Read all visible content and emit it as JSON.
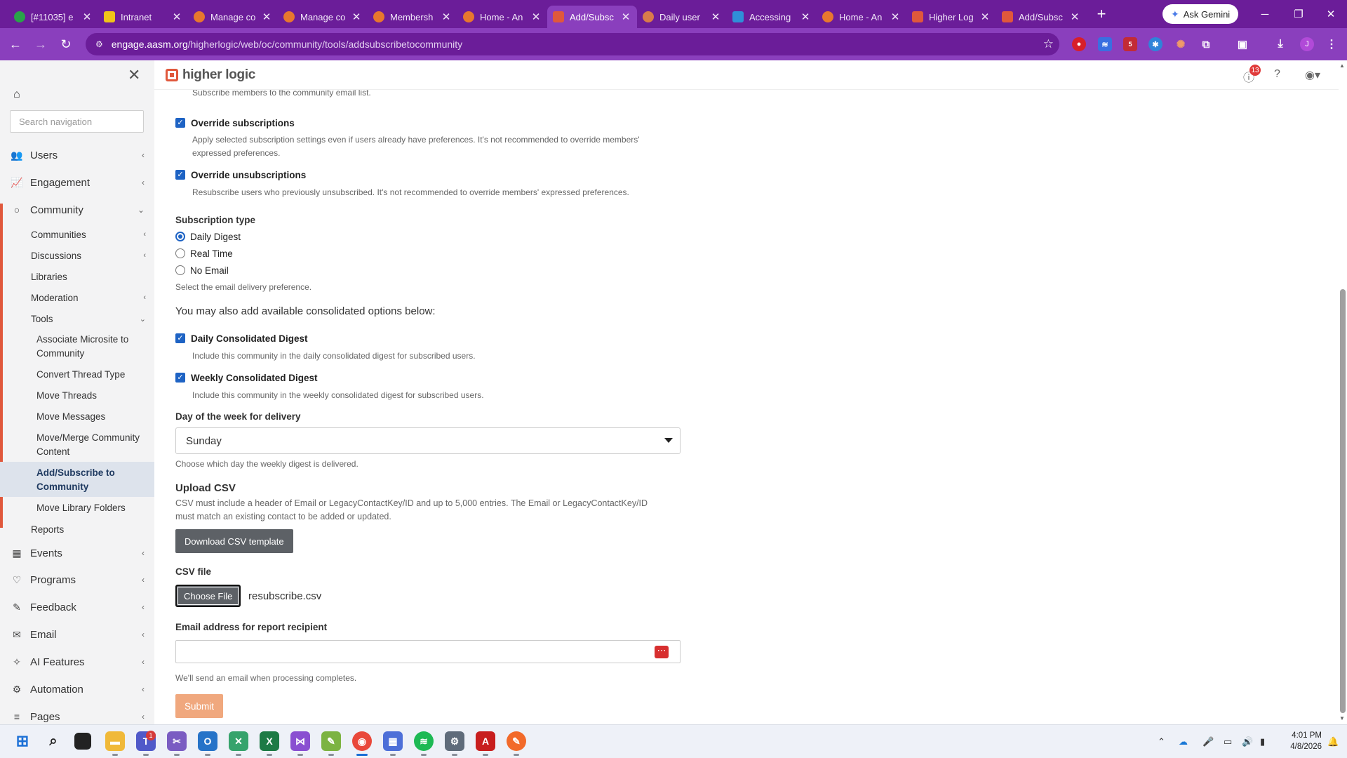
{
  "browser": {
    "tabs": [
      {
        "title": "[#11035] e",
        "color": "#2aa24a"
      },
      {
        "title": "Intranet",
        "color": "#f0c419"
      },
      {
        "title": "Manage co",
        "color": "#e8772e"
      },
      {
        "title": "Manage co",
        "color": "#e8772e"
      },
      {
        "title": "Membersh",
        "color": "#e8772e"
      },
      {
        "title": "Home - An",
        "color": "#e8772e"
      },
      {
        "title": "Add/Subsc",
        "color": "#e0583c",
        "active": true
      },
      {
        "title": "Daily user",
        "color": "#d97b4a"
      },
      {
        "title": "Accessing",
        "color": "#2f8fd8"
      },
      {
        "title": "Home - An",
        "color": "#e8772e"
      },
      {
        "title": "Higher Log",
        "color": "#e0583c"
      },
      {
        "title": "Add/Subsc",
        "color": "#e0583c"
      }
    ],
    "ask_gemini": "Ask Gemini",
    "url_domain": "engage.aasm.org",
    "url_path": "/higherlogic/web/oc/community/tools/addsubscribetocommunity",
    "profile_initial": "J",
    "extension_badge": "5"
  },
  "app": {
    "logo_text": "higher logic",
    "notification_count": "13"
  },
  "sidebar": {
    "search_placeholder": "Search navigation",
    "items": {
      "users": "Users",
      "engagement": "Engagement",
      "community": "Community",
      "events": "Events",
      "programs": "Programs",
      "feedback": "Feedback",
      "email": "Email",
      "ai_features": "AI Features",
      "automation": "Automation",
      "pages": "Pages"
    },
    "community_sub": {
      "communities": "Communities",
      "discussions": "Discussions",
      "libraries": "Libraries",
      "moderation": "Moderation",
      "tools": "Tools",
      "reports": "Reports"
    },
    "tools_sub": {
      "associate_microsite": "Associate Microsite to Community",
      "convert_thread": "Convert Thread Type",
      "move_threads": "Move Threads",
      "move_messages": "Move Messages",
      "move_merge": "Move/Merge Community Content",
      "add_subscribe": "Add/Subscribe to Community",
      "move_library": "Move Library Folders"
    }
  },
  "form": {
    "top_help": "Subscribe members to the community email list.",
    "override_subs_label": "Override subscriptions",
    "override_subs_help_1": "Apply selected subscription settings even if users already have preferences. It's not recommended to override members'",
    "override_subs_help_2": "expressed preferences.",
    "override_unsubs_label": "Override unsubscriptions",
    "override_unsubs_help": "Resubscribe users who previously unsubscribed. It's not recommended to override members' expressed preferences.",
    "subscription_type_label": "Subscription type",
    "sub_daily": "Daily Digest",
    "sub_realtime": "Real Time",
    "sub_none": "No Email",
    "subscription_help": "Select the email delivery preference.",
    "consolidated_intro": "You may also add available consolidated options below:",
    "daily_consolidated_label": "Daily Consolidated Digest",
    "daily_consolidated_help": "Include this community in the daily consolidated digest for subscribed users.",
    "weekly_consolidated_label": "Weekly Consolidated Digest",
    "weekly_consolidated_help": "Include this community in the weekly consolidated digest for subscribed users.",
    "day_label": "Day of the week for delivery",
    "day_value": "Sunday",
    "day_help": "Choose which day the weekly digest is delivered.",
    "upload_heading": "Upload CSV",
    "upload_help_1": "CSV must include a header of Email or LegacyContactKey/ID and up to 5,000 entries. The Email or LegacyContactKey/ID",
    "upload_help_2": "must match an existing contact to be added or updated.",
    "download_template": "Download CSV template",
    "csv_file_label": "CSV file",
    "choose_file": "Choose File",
    "file_name": "resubscribe.csv",
    "email_label": "Email address for report recipient",
    "email_value": "",
    "email_help": "We'll send an email when processing completes.",
    "submit": "Submit"
  },
  "taskbar": {
    "time": "4:01 PM",
    "date": "4/8/2026",
    "teams_badge": "1"
  }
}
